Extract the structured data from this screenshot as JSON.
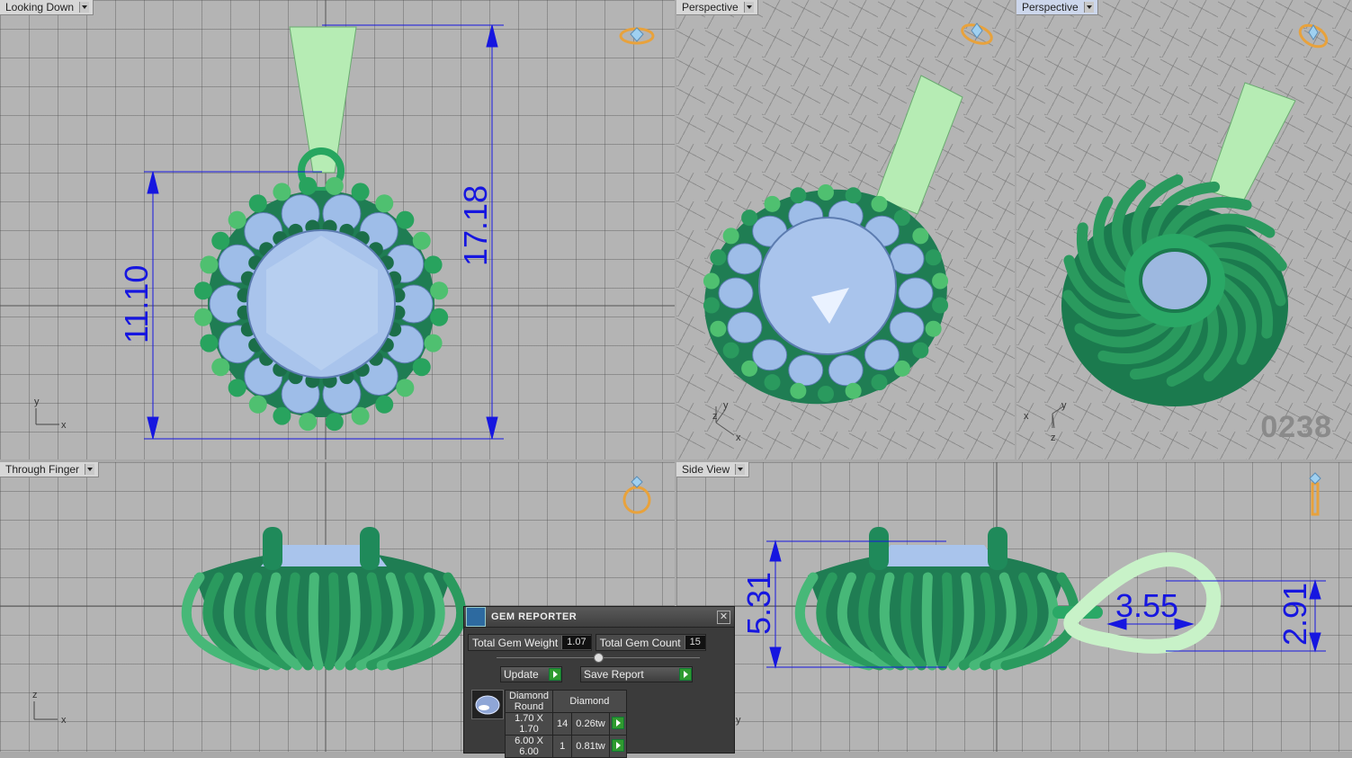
{
  "viewports": {
    "top_left": {
      "label": "Looking Down"
    },
    "top_mid": {
      "label": "Perspective"
    },
    "top_right": {
      "label": "Perspective"
    },
    "bottom_left": {
      "label": "Through Finger"
    },
    "bottom_right": {
      "label": "Side View"
    }
  },
  "dimensions": {
    "height_main": "11.10",
    "height_total": "17.18",
    "depth": "5.31",
    "bail_width": "3.55",
    "bail_height": "2.91"
  },
  "watermark": "0238",
  "axis_labels": {
    "x": "x",
    "y": "y",
    "z": "z"
  },
  "gem_reporter": {
    "title": "GEM REPORTER",
    "total_weight_label": "Total Gem Weight",
    "total_weight_value": "1.07",
    "total_count_label": "Total Gem Count",
    "total_count_value": "15",
    "update_label": "Update",
    "save_label": "Save Report",
    "table_headers": [
      "Diamond Round",
      "Diamond"
    ],
    "rows": [
      {
        "size": "1.70 X 1.70",
        "count": "14",
        "weight": "0.26tw"
      },
      {
        "size": "6.00 X 6.00",
        "count": "1",
        "weight": "0.81tw"
      }
    ]
  },
  "colors": {
    "dimension": "#1616e0",
    "metal_light": "#a8e6ae",
    "metal_dark": "#1f8a5a",
    "gem": "#a9c4ec"
  }
}
